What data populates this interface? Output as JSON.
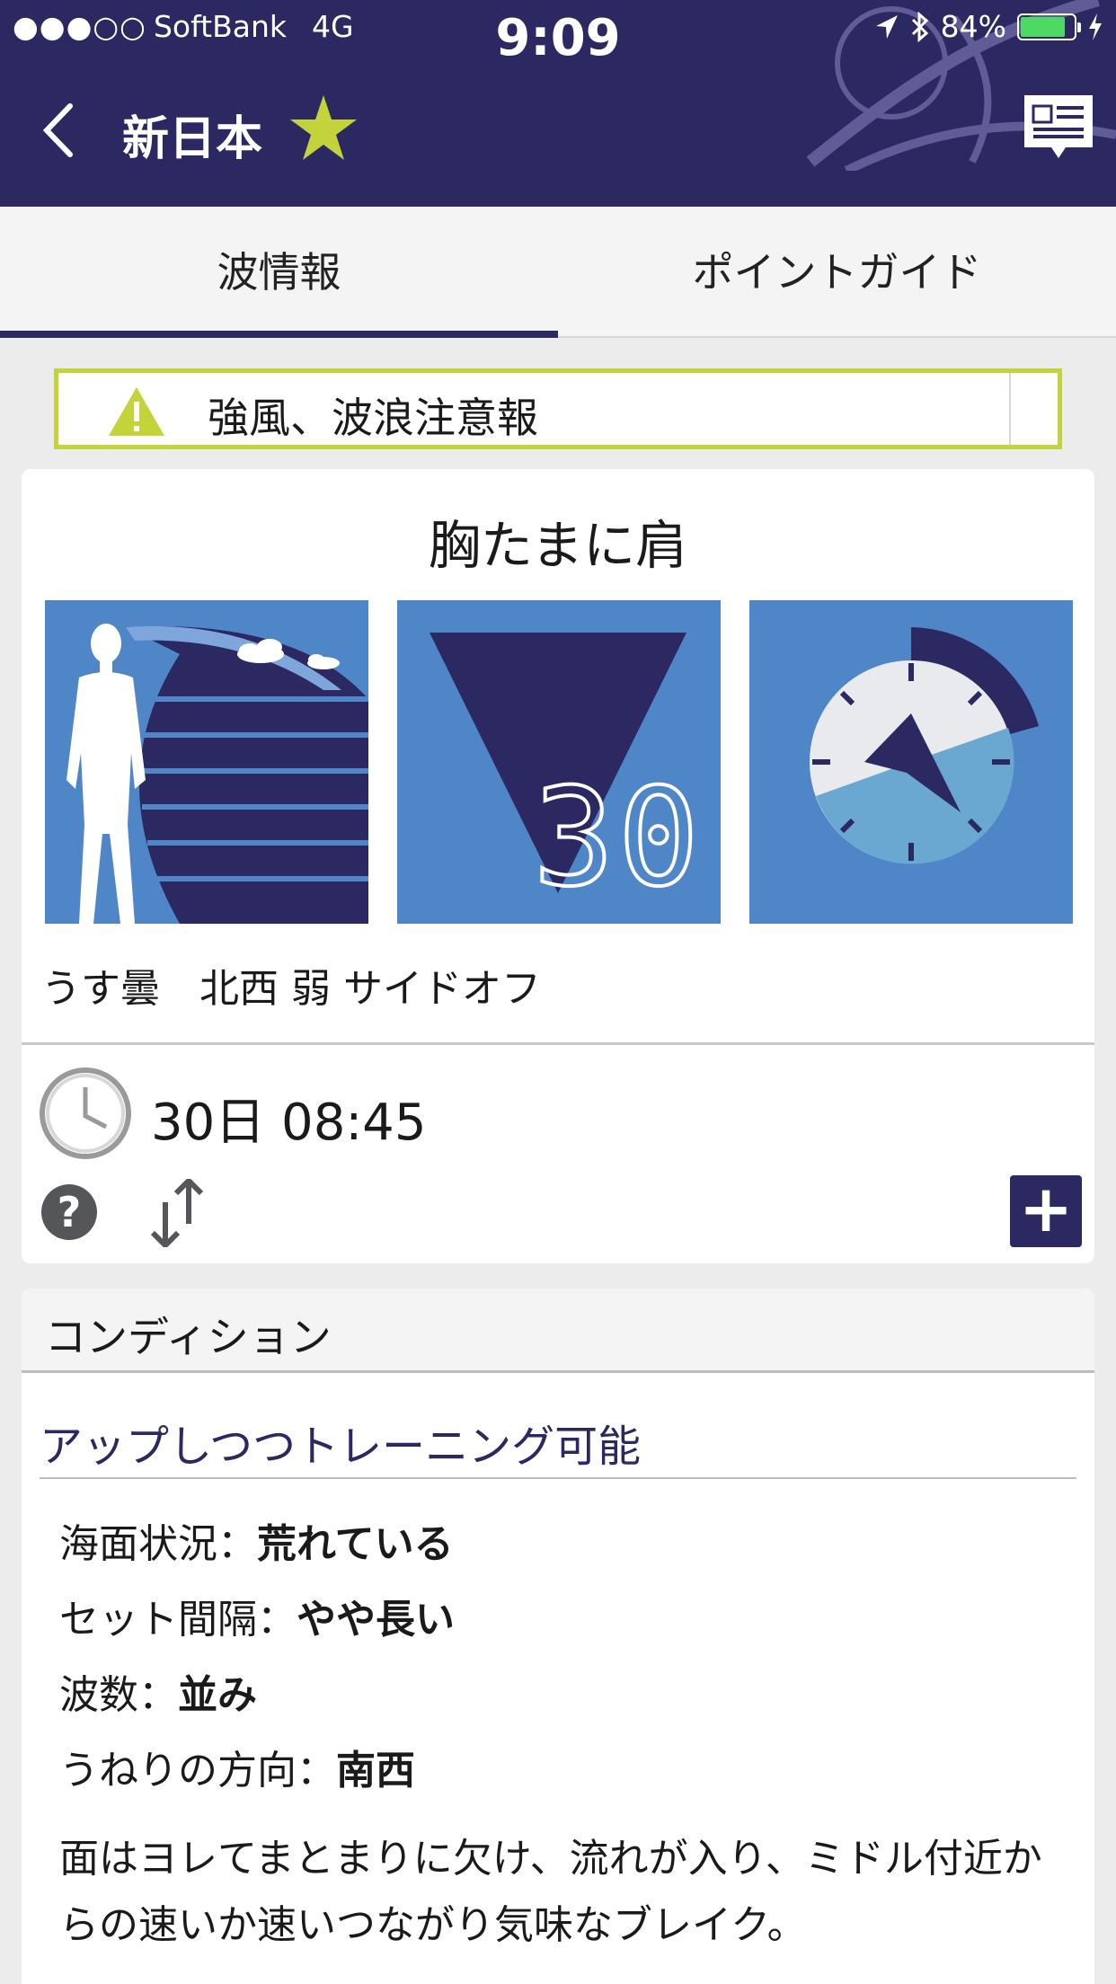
{
  "status_bar": {
    "signal": "●●●○○",
    "carrier": "SoftBank",
    "network": "4G",
    "time": "9:09",
    "battery": "84%",
    "battery_level": 0.84
  },
  "header": {
    "title": "新日本",
    "favorite": true
  },
  "tabs": [
    {
      "label": "波情報",
      "active": true
    },
    {
      "label": "ポイントガイド",
      "active": false
    }
  ],
  "alert": {
    "text": "強風、波浪注意報"
  },
  "wave": {
    "size_text": "胸たまに肩",
    "rating": "30",
    "weather_text": "うす曇　北西 弱 サイドオフ",
    "time": "30日 08:45"
  },
  "condition": {
    "header": "コンディション",
    "summary": "アップしつつトレーニング可能",
    "rows": [
      {
        "label": "海面状況：",
        "value": "荒れている"
      },
      {
        "label": "セット間隔：",
        "value": "やや長い"
      },
      {
        "label": "波数：",
        "value": "並み"
      },
      {
        "label": "うねりの方向：",
        "value": "南西"
      }
    ],
    "description": "面はヨレてまとまりに欠け、流れが入り、ミドル付近からの速いか速いつながり気味なブレイク。"
  },
  "colors": {
    "navy": "#2c2862",
    "tile_blue": "#4f86c8",
    "alert_border": "#c3d43a",
    "star": "#c3d43a"
  }
}
